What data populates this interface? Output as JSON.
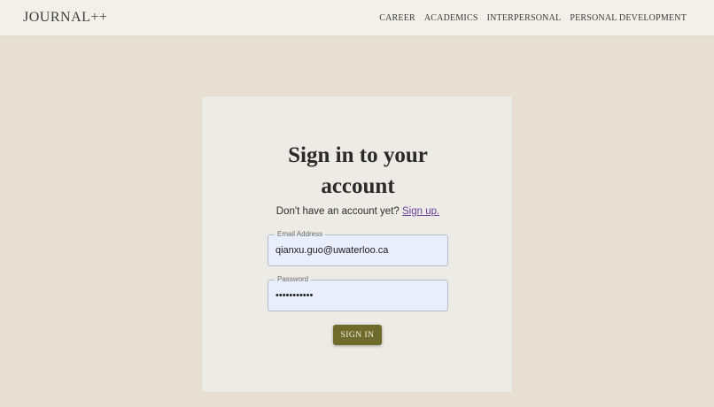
{
  "navbar": {
    "brand": "JOURNAL++",
    "links": [
      "CAREER",
      "ACADEMICS",
      "INTERPERSONAL",
      "PERSONAL DEVELOPMENT"
    ]
  },
  "signin": {
    "title_line1": "Sign in to your",
    "title_line2": "account",
    "prompt": "Don't have an account yet?",
    "signup_link": "Sign up.",
    "email_label": "Email Address",
    "email_value": "qianxu.guo@uwaterloo.ca",
    "password_label": "Password",
    "password_value": "•••••••••••",
    "button": "SIGN IN"
  },
  "colors": {
    "page_background": "#e6dfd2",
    "navbar_background": "#f3f0eb",
    "card_background": "#ecebe6",
    "input_background": "#e8eefb",
    "button_background": "#6f6b2b",
    "link": "#6a3d9a"
  }
}
